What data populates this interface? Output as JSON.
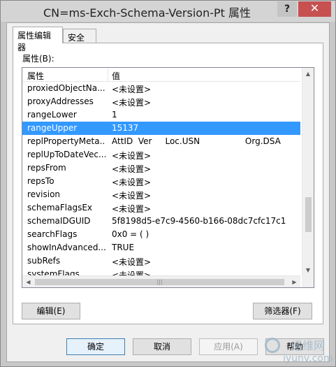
{
  "window": {
    "title": "CN=ms-Exch-Schema-Version-Pt 属性",
    "help_label": "?",
    "close_label": "✕"
  },
  "tabs": [
    {
      "label": "属性编辑器"
    },
    {
      "label": "安全"
    }
  ],
  "attributes_label": "属性(B):",
  "list": {
    "headers": {
      "name": "属性",
      "value": "值"
    },
    "rows": [
      {
        "name": "proxiedObjectNa...",
        "value": "<未设置>"
      },
      {
        "name": "proxyAddresses",
        "value": "<未设置>"
      },
      {
        "name": "rangeLower",
        "value": "1"
      },
      {
        "name": "rangeUpper",
        "value": "15137"
      },
      {
        "name": "replPropertyMeta...",
        "value": "AttID  Ver     Loc.USN                 Org.DSA"
      },
      {
        "name": "replUpToDateVec...",
        "value": "<未设置>"
      },
      {
        "name": "repsFrom",
        "value": "<未设置>"
      },
      {
        "name": "repsTo",
        "value": "<未设置>"
      },
      {
        "name": "revision",
        "value": "<未设置>"
      },
      {
        "name": "schemaFlagsEx",
        "value": "<未设置>"
      },
      {
        "name": "schemaIDGUID",
        "value": "5f8198d5-e7c9-4560-b166-08dc7cfc17c1"
      },
      {
        "name": "searchFlags",
        "value": "0x0 = ( )"
      },
      {
        "name": "showInAdvanced...",
        "value": "TRUE"
      },
      {
        "name": "subRefs",
        "value": "<未设置>"
      },
      {
        "name": "systemFlags",
        "value": "<未设置>"
      }
    ],
    "selected_index": 3
  },
  "buttons": {
    "edit": "编辑(E)",
    "filter": "筛选器(F)",
    "ok": "确定",
    "cancel": "取消",
    "apply": "应用(A)",
    "help": "帮助"
  },
  "watermark": {
    "line1": "运维网",
    "line2": "iyunv.com"
  }
}
